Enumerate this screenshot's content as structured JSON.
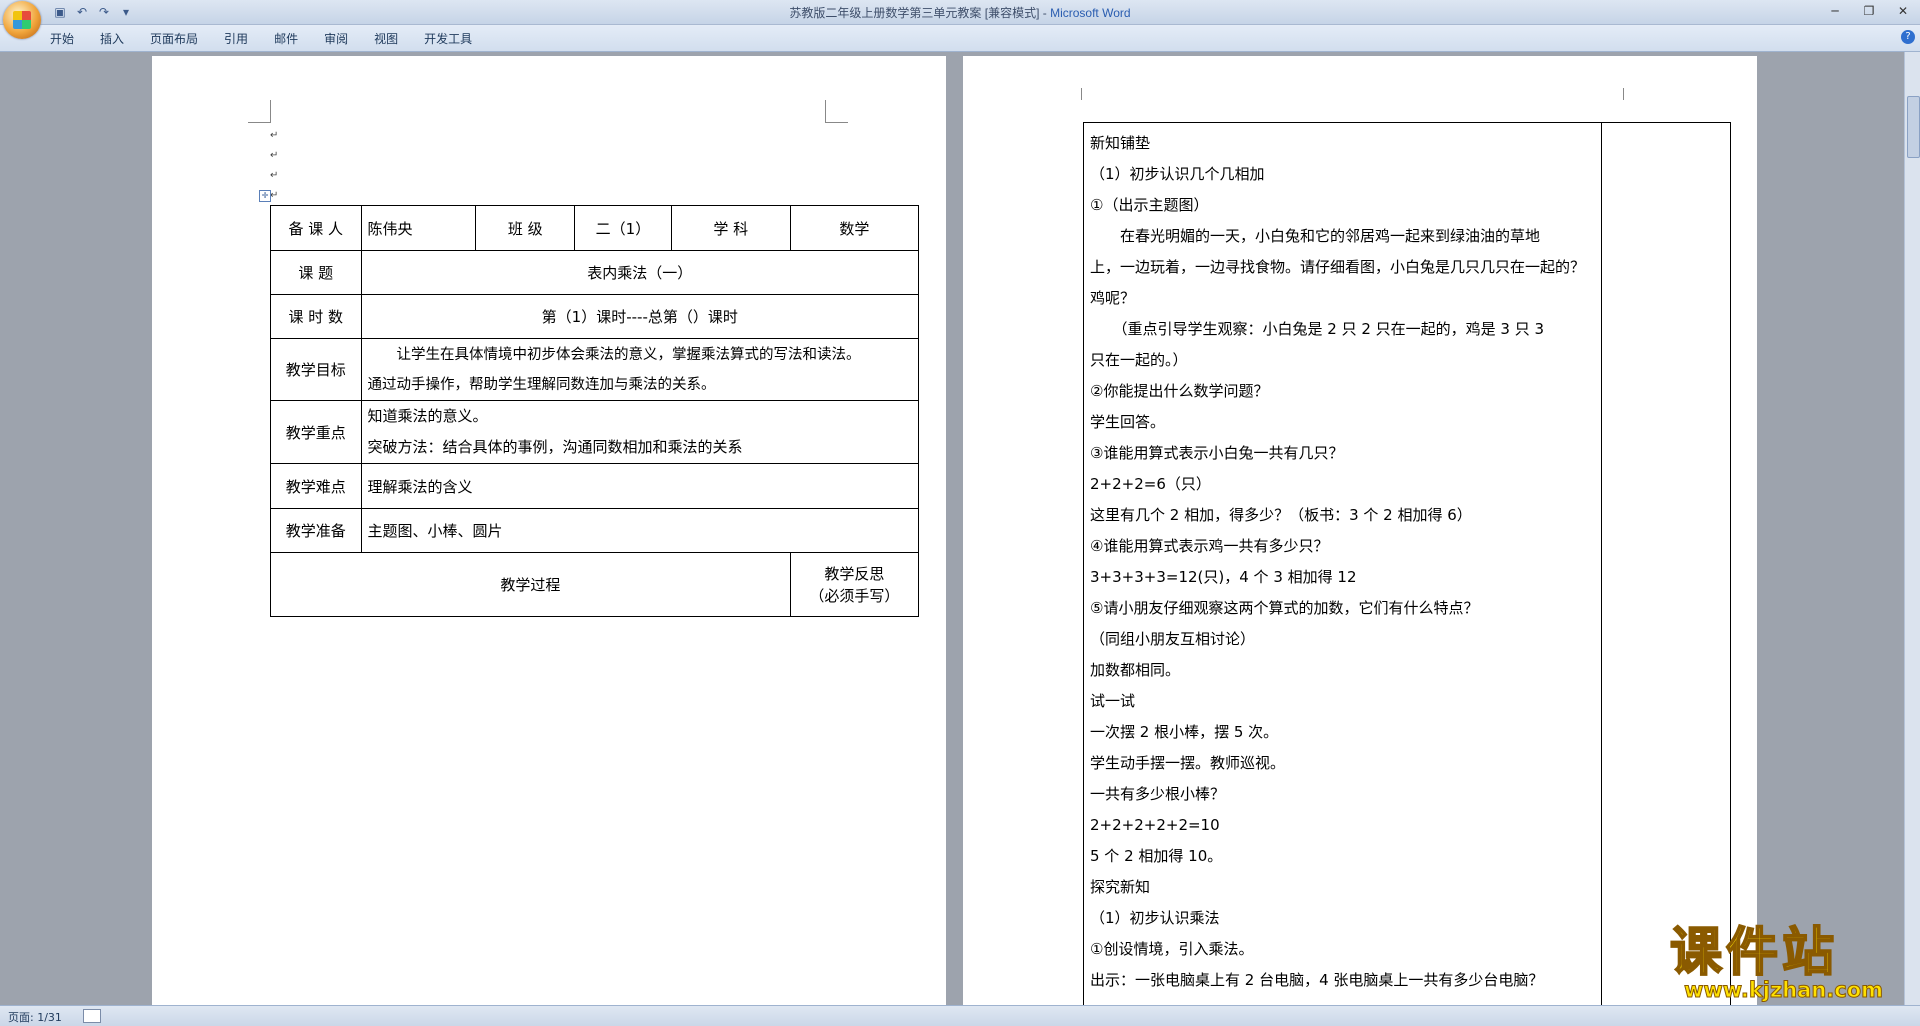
{
  "window": {
    "title_doc": "苏教版二年级上册数学第三单元教案 [兼容模式] - ",
    "title_app": "Microsoft Word"
  },
  "ribbon": {
    "tabs": [
      "开始",
      "插入",
      "页面布局",
      "引用",
      "邮件",
      "审阅",
      "视图",
      "开发工具"
    ]
  },
  "lesson_table": {
    "preparer_label": "备 课 人",
    "preparer": "陈伟央",
    "class_label": "班  级",
    "class_value": "二（1）",
    "subject_label": "学  科",
    "subject_value": "数学",
    "topic_label": "课    题",
    "topic": "表内乘法（一）",
    "period_label": "课 时 数",
    "period": "第（1）课时----总第（）课时",
    "goal_label": "教学目标",
    "goal_line1": "　　让学生在具体情境中初步体会乘法的意义，掌握乘法算式的写法和读法。",
    "goal_line2": "通过动手操作，帮助学生理解同数连加与乘法的关系。",
    "key_label": "教学重点",
    "key_line1": "知道乘法的意义。",
    "key_line2": "突破方法：结合具体的事例，沟通同数相加和乘法的关系",
    "difficulty_label": "教学难点",
    "difficulty": "理解乘法的含义",
    "prep_label": "教学准备",
    "prep": "主题图、小棒、圆片",
    "process_label": "教学过程",
    "reflection_line1": "教学反思",
    "reflection_line2": "（必须手写）"
  },
  "lesson_body": [
    "新知铺垫",
    "（1）初步认识几个几相加",
    "①（出示主题图）",
    "　　在春光明媚的一天，小白兔和它的邻居鸡一起来到绿油油的草地",
    "上，一边玩着，一边寻找食物。请仔细看图，小白兔是几只几只在一起的？",
    "鸡呢？",
    "　　（重点引导学生观察：小白兔是 2 只 2 只在一起的，鸡是 3 只 3",
    "只在一起的。）",
    "②你能提出什么数学问题？",
    "学生回答。",
    "③谁能用算式表示小白兔一共有几只？",
    "2+2+2=6（只）",
    "这里有几个 2 相加，得多少？（板书：3 个 2 相加得 6）",
    "④谁能用算式表示鸡一共有多少只？",
    "3+3+3+3=12(只)，4 个 3 相加得 12",
    "⑤请小朋友仔细观察这两个算式的加数，它们有什么特点？",
    "（同组小朋友互相讨论）",
    "加数都相同。",
    "试一试",
    "一次摆 2 根小棒，摆 5 次。",
    "学生动手摆一摆。教师巡视。",
    "一共有多少根小棒？",
    "2+2+2+2+2=10",
    "5 个 2 相加得 10。",
    "探究新知",
    "（1）初步认识乘法",
    "①创设情境，引入乘法。",
    "出示：一张电脑桌上有 2 台电脑，4 张电脑桌上一共有多少台电脑？"
  ],
  "status": {
    "page": "页面: 1/31"
  },
  "watermark": {
    "text": "课件站",
    "url": "www.kjzhan.com"
  }
}
